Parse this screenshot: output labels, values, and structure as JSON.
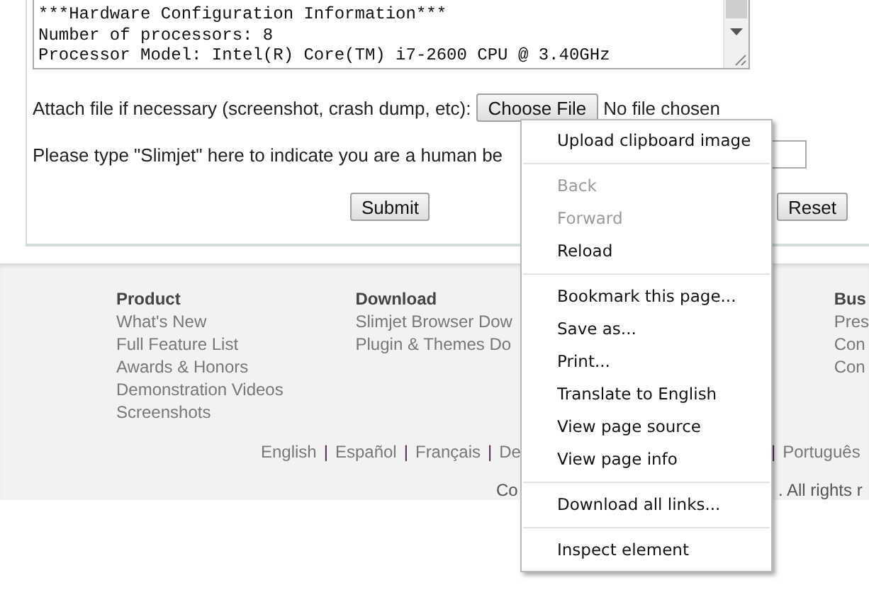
{
  "report_box": {
    "lines": [
      "***Hardware Configuration Information***",
      "Number of processors: 8",
      "Processor Model: Intel(R) Core(TM) i7-2600 CPU @ 3.40GHz"
    ]
  },
  "attach": {
    "label": "Attach file if necessary (screenshot, crash dump, etc):",
    "button": "Choose File",
    "status": "No file chosen"
  },
  "human_check": {
    "label": "Please type \"Slimjet\" here to indicate you are a human be"
  },
  "buttons": [
    "Submit",
    "Reset"
  ],
  "footer": {
    "columns": [
      {
        "heading": "Product",
        "links": [
          "What's New",
          "Full Feature List",
          "Awards & Honors",
          "Demonstration Videos",
          "Screenshots"
        ]
      },
      {
        "heading": "Download",
        "links": [
          "Slimjet Browser Dow",
          "Plugin & Themes Do"
        ]
      },
      {
        "heading": "Bus",
        "links": [
          "Pres",
          "Con",
          "Con"
        ]
      }
    ],
    "languages_left": [
      {
        "label": "English"
      },
      {
        "separator": "|",
        "label": "Español"
      },
      {
        "separator": "|",
        "label": "Français"
      },
      {
        "separator": "|",
        "label": "De"
      }
    ],
    "languages_right": [
      {
        "separator": "|",
        "label": "Português"
      }
    ],
    "copyright_left": "Co",
    "copyright_right": ". All rights r"
  },
  "context_menu": {
    "groups": [
      [
        {
          "label": "Upload clipboard image",
          "disabled": false
        }
      ],
      [
        {
          "label": "Back",
          "disabled": true
        },
        {
          "label": "Forward",
          "disabled": true
        },
        {
          "label": "Reload",
          "disabled": false
        }
      ],
      [
        {
          "label": "Bookmark this page...",
          "disabled": false
        },
        {
          "label": "Save as...",
          "disabled": false
        },
        {
          "label": "Print...",
          "disabled": false
        },
        {
          "label": "Translate to English",
          "disabled": false
        },
        {
          "label": "View page source",
          "disabled": false
        },
        {
          "label": "View page info",
          "disabled": false
        }
      ],
      [
        {
          "label": "Download all links...",
          "disabled": false
        }
      ],
      [
        {
          "label": "Inspect element",
          "disabled": false
        }
      ]
    ]
  }
}
